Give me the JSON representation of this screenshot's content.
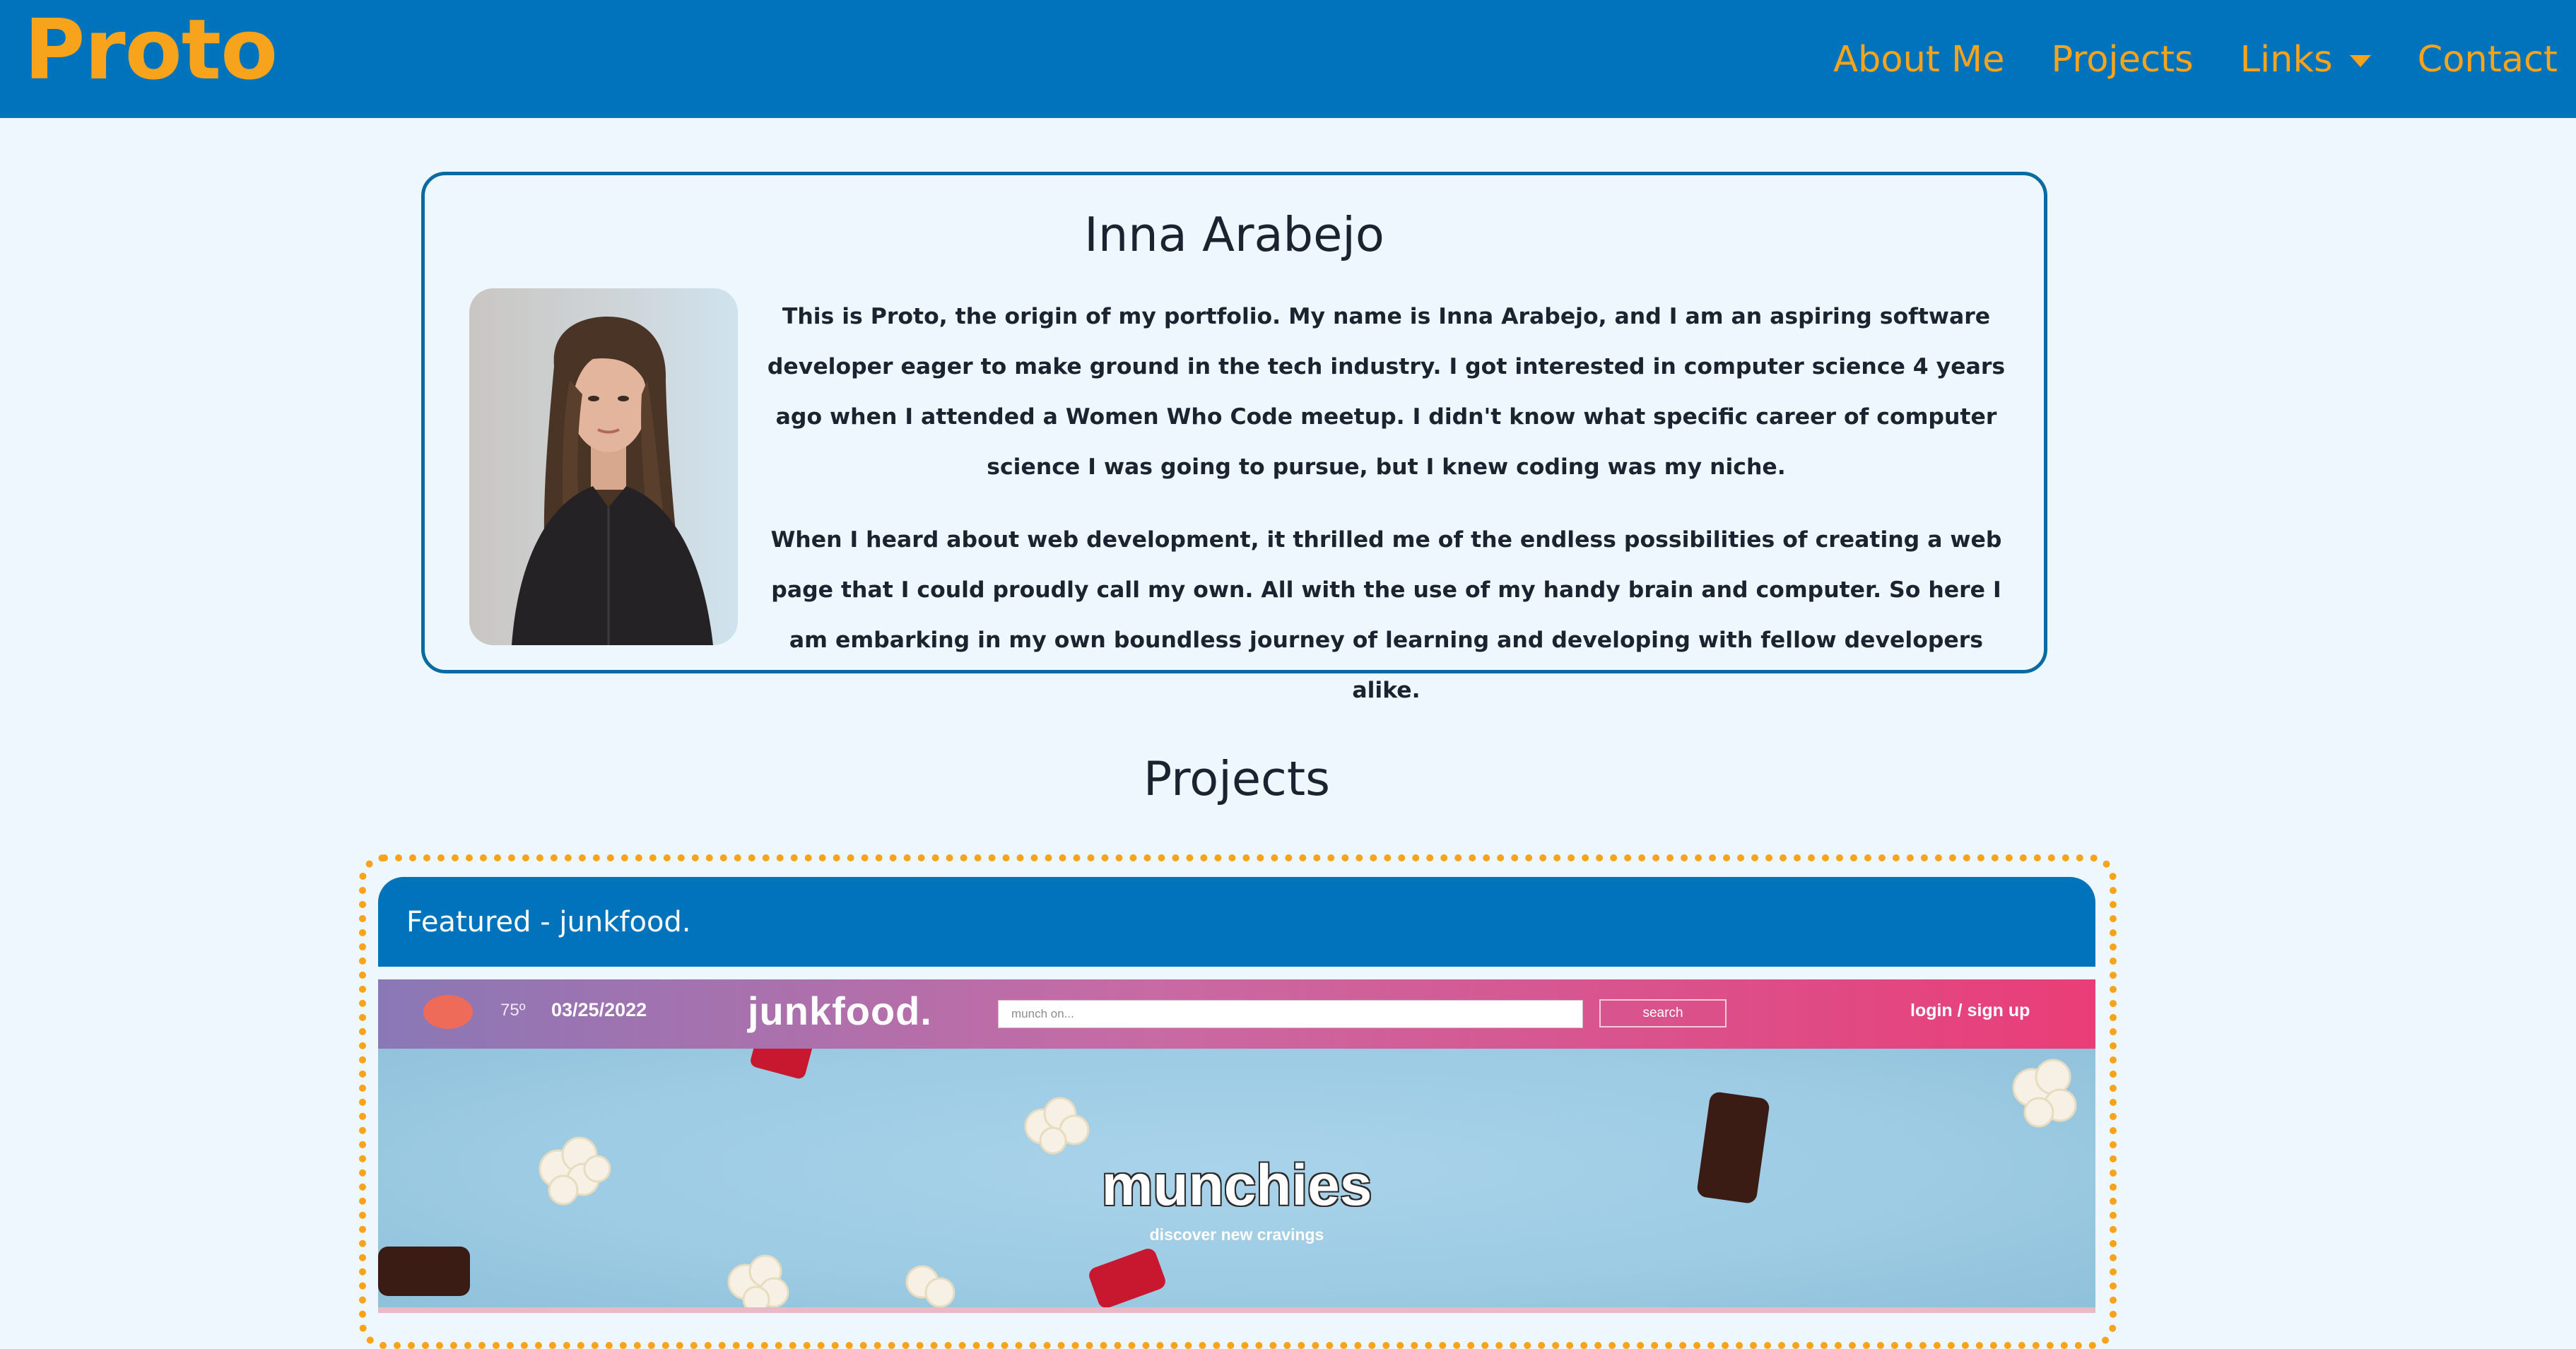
{
  "navbar": {
    "brand": "Proto",
    "links": [
      {
        "label": "About Me"
      },
      {
        "label": "Projects"
      },
      {
        "label": "Links"
      },
      {
        "label": "Contact"
      }
    ]
  },
  "about": {
    "name": "Inna Arabejo",
    "paragraphs": [
      "This is Proto, the origin of my portfolio. My name is Inna Arabejo, and I am an aspiring software developer eager to make ground in the tech industry. I got interested in computer science 4 years ago when I attended a Women Who Code meetup. I didn't know what specific career of computer science I was going to pursue, but I knew coding was my niche.",
      "When I heard about web development, it thrilled me of the endless possibilities of creating a web page that I could proudly call my own. All with the use of my handy brain and computer. So here I am embarking in my own boundless journey of learning and developing with fellow developers alike."
    ]
  },
  "projects": {
    "title": "Projects",
    "featured": {
      "title": "Featured - junkfood.",
      "screenshot": {
        "temperature": "75º",
        "date": "03/25/2022",
        "logo": "junkfood.",
        "search_placeholder": "munch on...",
        "search_button": "search",
        "login": "login / sign up",
        "hero_title": "munchies",
        "hero_subtitle": "discover new cravings"
      }
    }
  },
  "colors": {
    "nav_bg": "#0073bd",
    "accent": "#f8a31c",
    "page_bg": "#eef7fd",
    "card_border": "#0a6ba3"
  }
}
